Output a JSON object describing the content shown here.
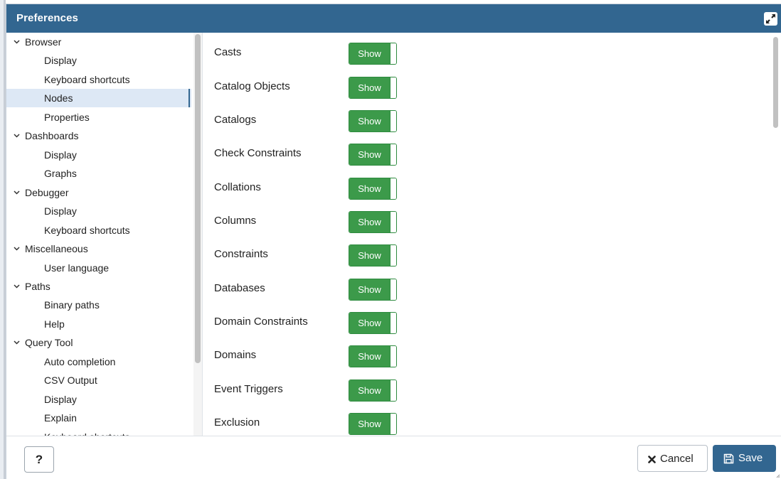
{
  "window": {
    "title": "Preferences"
  },
  "tree": {
    "items": [
      {
        "label": "Browser",
        "type": "group"
      },
      {
        "label": "Display",
        "type": "child"
      },
      {
        "label": "Keyboard shortcuts",
        "type": "child"
      },
      {
        "label": "Nodes",
        "type": "child",
        "selected": true
      },
      {
        "label": "Properties",
        "type": "child"
      },
      {
        "label": "Dashboards",
        "type": "group"
      },
      {
        "label": "Display",
        "type": "child"
      },
      {
        "label": "Graphs",
        "type": "child"
      },
      {
        "label": "Debugger",
        "type": "group"
      },
      {
        "label": "Display",
        "type": "child"
      },
      {
        "label": "Keyboard shortcuts",
        "type": "child"
      },
      {
        "label": "Miscellaneous",
        "type": "group"
      },
      {
        "label": "User language",
        "type": "child"
      },
      {
        "label": "Paths",
        "type": "group"
      },
      {
        "label": "Binary paths",
        "type": "child"
      },
      {
        "label": "Help",
        "type": "child"
      },
      {
        "label": "Query Tool",
        "type": "group"
      },
      {
        "label": "Auto completion",
        "type": "child"
      },
      {
        "label": "CSV Output",
        "type": "child"
      },
      {
        "label": "Display",
        "type": "child"
      },
      {
        "label": "Explain",
        "type": "child"
      },
      {
        "label": "Keyboard shortcuts",
        "type": "child"
      }
    ]
  },
  "nodes": {
    "toggle_label": "Show",
    "items": [
      {
        "label": "Casts"
      },
      {
        "label": "Catalog Objects"
      },
      {
        "label": "Catalogs"
      },
      {
        "label": "Check Constraints"
      },
      {
        "label": "Collations"
      },
      {
        "label": "Columns"
      },
      {
        "label": "Constraints"
      },
      {
        "label": "Databases"
      },
      {
        "label": "Domain Constraints"
      },
      {
        "label": "Domains"
      },
      {
        "label": "Event Triggers"
      },
      {
        "label": "Exclusion"
      }
    ]
  },
  "footer": {
    "help_label": "?",
    "cancel_label": "Cancel",
    "save_label": "Save"
  },
  "colors": {
    "titlebar": "#326690",
    "toggle_on": "#3c9a4a",
    "save_button": "#326690",
    "selected_row": "#dde8f5"
  }
}
